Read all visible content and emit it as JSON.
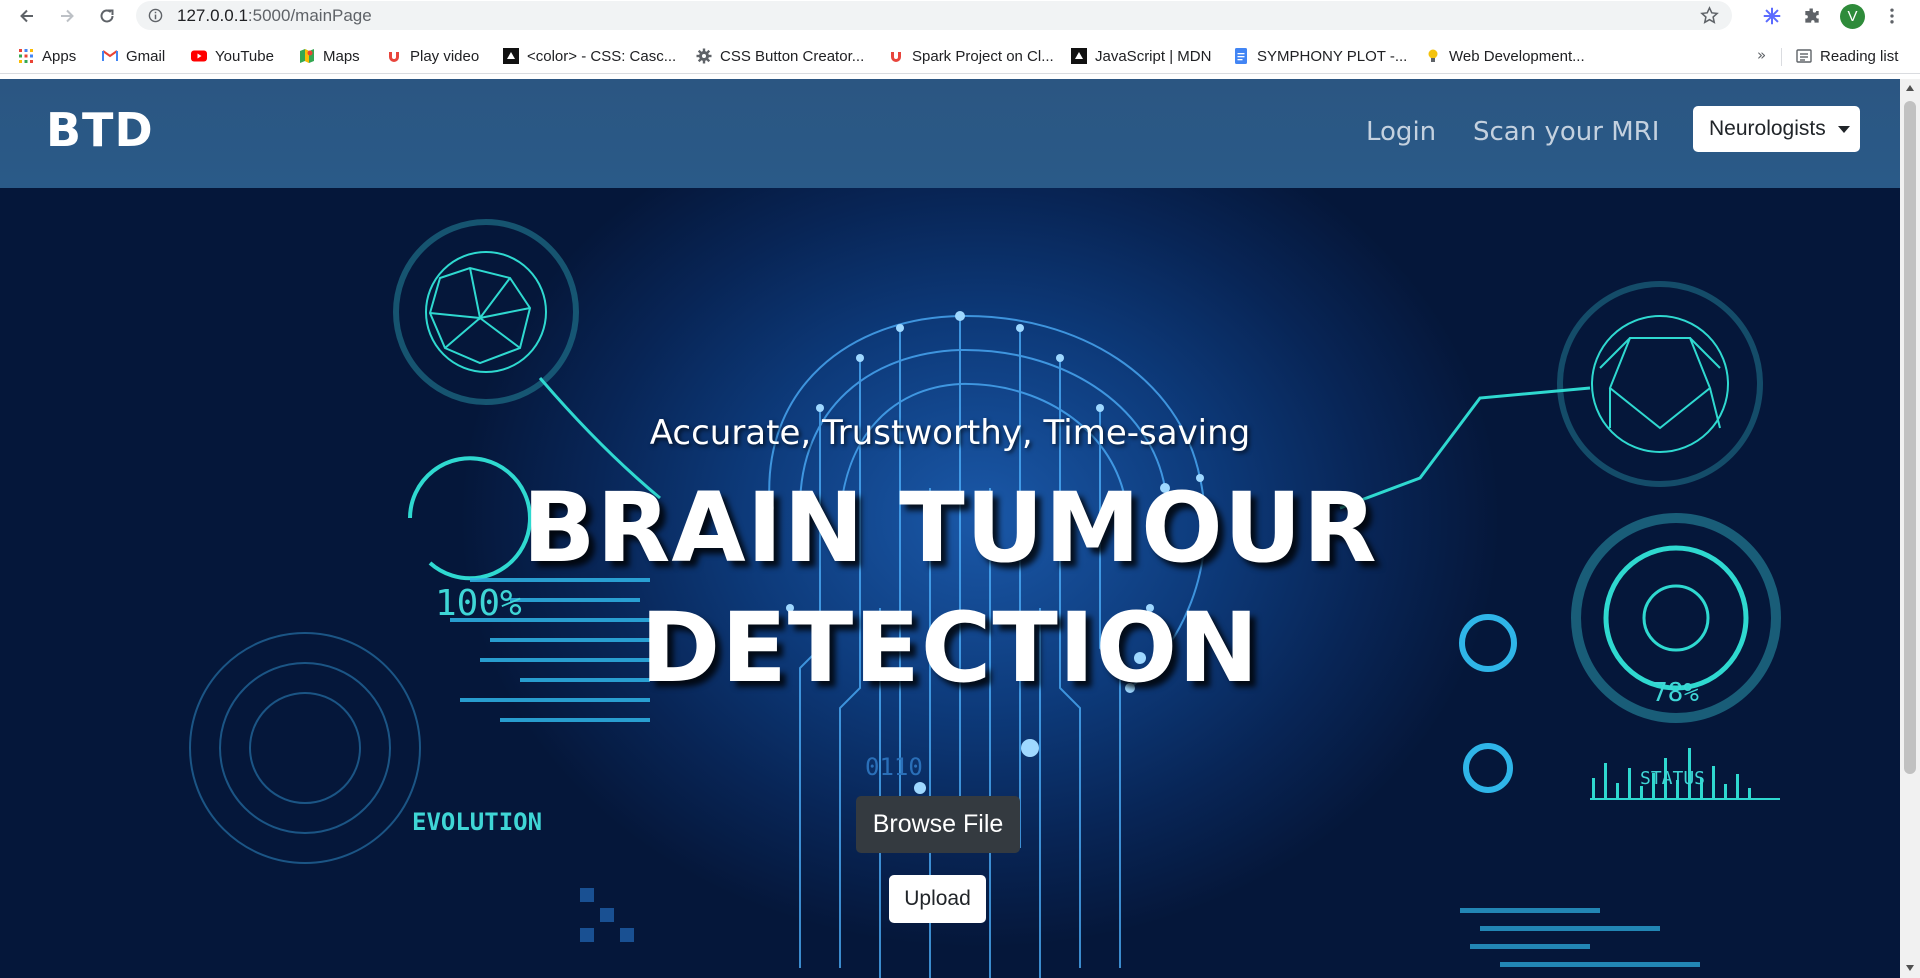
{
  "browser": {
    "url_host": "127.0.0.1",
    "url_path": ":5000/mainPage",
    "profile_initial": "V",
    "bookmarks": [
      {
        "label": "Apps",
        "icon": "apps-grid-icon"
      },
      {
        "label": "Gmail",
        "icon": "gmail-icon"
      },
      {
        "label": "YouTube",
        "icon": "youtube-icon"
      },
      {
        "label": "Maps",
        "icon": "maps-icon"
      },
      {
        "label": "Play video",
        "icon": "udemy-icon"
      },
      {
        "label": "<color> - CSS: Casc...",
        "icon": "mdn-icon"
      },
      {
        "label": "CSS Button Creator...",
        "icon": "gear-icon"
      },
      {
        "label": "Spark Project on Cl...",
        "icon": "udemy-icon"
      },
      {
        "label": "JavaScript | MDN",
        "icon": "mdn-icon"
      },
      {
        "label": "SYMPHONY PLOT -...",
        "icon": "docs-icon"
      },
      {
        "label": "Web Development...",
        "icon": "lightbulb-icon"
      }
    ],
    "more_label": "»",
    "reading_list": "Reading list"
  },
  "navbar": {
    "brand": "BTD",
    "links": [
      "Login",
      "Scan your MRI"
    ],
    "dropdown_label": "Neurologists"
  },
  "hero": {
    "tagline": "Accurate, Trustworthy, Time-saving",
    "headline_line1": "BRAIN TUMOUR",
    "headline_line2": "DETECTION",
    "browse_label": "Browse File",
    "upload_label": "Upload",
    "hud_percent_left": "100%",
    "hud_percent_right": "78%",
    "hud_status": "STATUS",
    "hud_evolution": "EVOLUTION",
    "hud_binary": "0110"
  },
  "colors": {
    "navbar": "#2b5682",
    "hero_dark": "#05173a",
    "hero_glow": "#1a58a8",
    "hud_cyan": "#3fd6d6",
    "browse_button": "#343a40"
  }
}
